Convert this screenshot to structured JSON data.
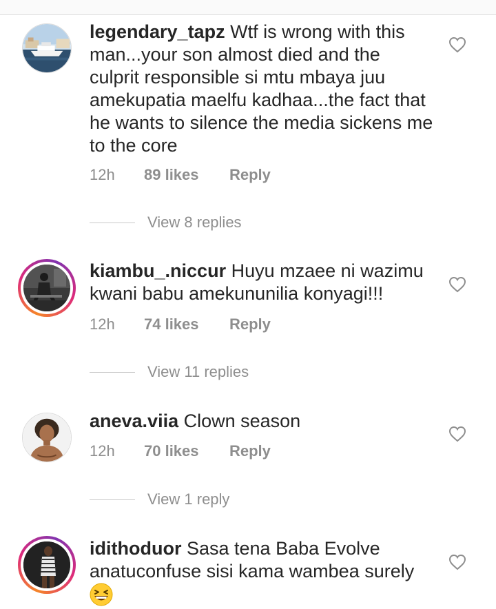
{
  "comments": [
    {
      "username": "legendary_tapz",
      "text": "Wtf is wrong with this man...your son almost died and the culprit responsible si mtu mbaya juu amekupatia maelfu kadhaa...the fact that he wants to silence the media sickens me to the core",
      "time": "12h",
      "likes": "89 likes",
      "reply": "Reply",
      "view_replies": "View 8 replies",
      "avatar_icon": "yacht-photo-icon",
      "story_ring": false
    },
    {
      "username": "kiambu_.niccur",
      "text": "Huyu mzaee ni wazimu kwani babu amekununilia konyagi!!!",
      "time": "12h",
      "likes": "74 likes",
      "reply": "Reply",
      "view_replies": "View 11 replies",
      "avatar_icon": "person-sitting-photo-icon",
      "story_ring": true
    },
    {
      "username": "aneva.viia",
      "text": "Clown season",
      "time": "12h",
      "likes": "70 likes",
      "reply": "Reply",
      "view_replies": "View 1 reply",
      "avatar_icon": "woman-portrait-photo-icon",
      "story_ring": false
    },
    {
      "username": "idithoduor",
      "text": "Sasa tena Baba Evolve anatuconfuse sisi kama wambea surely",
      "emoji": "grinning-squinting-face-icon",
      "avatar_icon": "person-standing-photo-icon",
      "story_ring": true
    }
  ],
  "colors": {
    "text": "#262626",
    "muted": "#8e8e8e",
    "story_ring_start": "#f58529",
    "story_ring_end": "#dd2a7b"
  }
}
